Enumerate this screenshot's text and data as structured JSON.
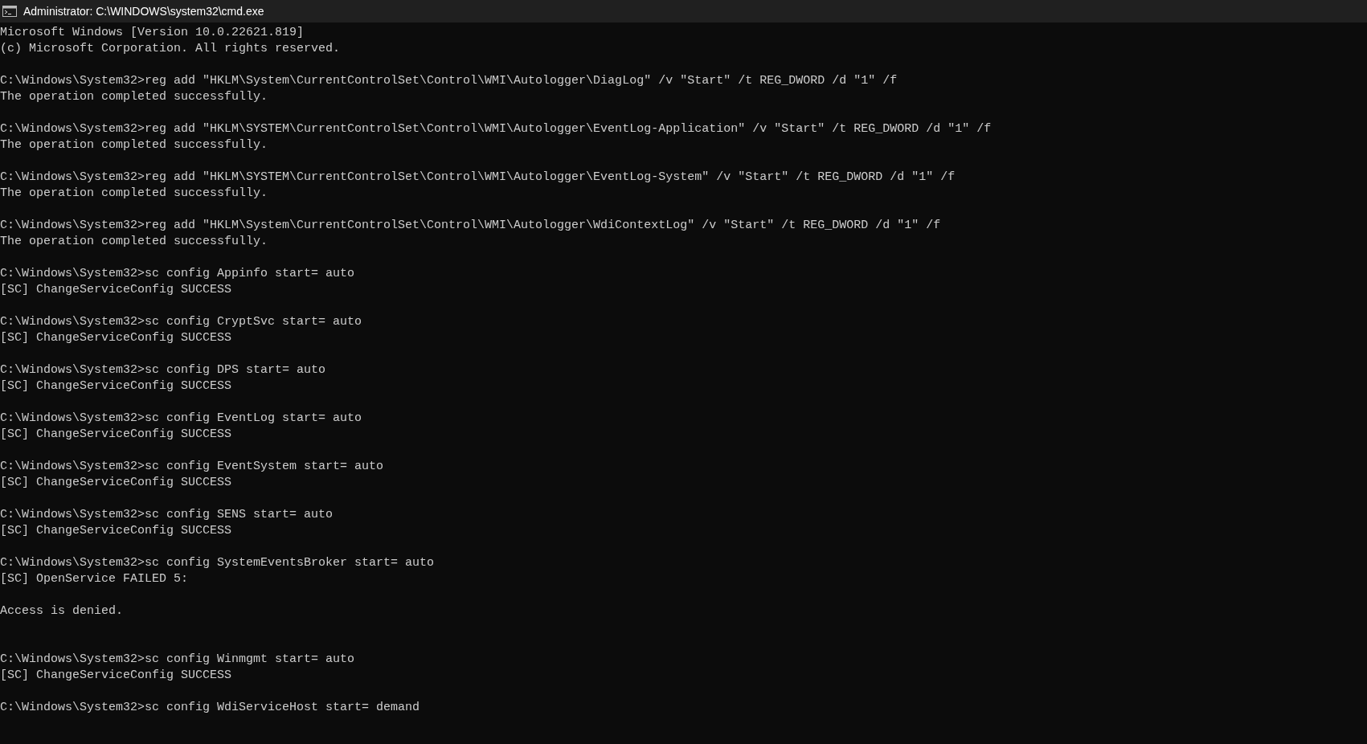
{
  "window": {
    "title": "Administrator: C:\\WINDOWS\\system32\\cmd.exe"
  },
  "console": {
    "lines": [
      {
        "kind": "text",
        "text": "Microsoft Windows [Version 10.0.22621.819]"
      },
      {
        "kind": "text",
        "text": "(c) Microsoft Corporation. All rights reserved."
      },
      {
        "kind": "blank"
      },
      {
        "kind": "text",
        "text": "C:\\Windows\\System32>reg add \"HKLM\\System\\CurrentControlSet\\Control\\WMI\\Autologger\\DiagLog\" /v \"Start\" /t REG_DWORD /d \"1\" /f"
      },
      {
        "kind": "text",
        "text": "The operation completed successfully."
      },
      {
        "kind": "blank"
      },
      {
        "kind": "text",
        "text": "C:\\Windows\\System32>reg add \"HKLM\\SYSTEM\\CurrentControlSet\\Control\\WMI\\Autologger\\EventLog-Application\" /v \"Start\" /t REG_DWORD /d \"1\" /f"
      },
      {
        "kind": "text",
        "text": "The operation completed successfully."
      },
      {
        "kind": "blank"
      },
      {
        "kind": "text",
        "text": "C:\\Windows\\System32>reg add \"HKLM\\SYSTEM\\CurrentControlSet\\Control\\WMI\\Autologger\\EventLog-System\" /v \"Start\" /t REG_DWORD /d \"1\" /f"
      },
      {
        "kind": "text",
        "text": "The operation completed successfully."
      },
      {
        "kind": "blank"
      },
      {
        "kind": "text",
        "text": "C:\\Windows\\System32>reg add \"HKLM\\System\\CurrentControlSet\\Control\\WMI\\Autologger\\WdiContextLog\" /v \"Start\" /t REG_DWORD /d \"1\" /f"
      },
      {
        "kind": "text",
        "text": "The operation completed successfully."
      },
      {
        "kind": "blank"
      },
      {
        "kind": "text",
        "text": "C:\\Windows\\System32>sc config Appinfo start= auto"
      },
      {
        "kind": "text",
        "text": "[SC] ChangeServiceConfig SUCCESS"
      },
      {
        "kind": "blank"
      },
      {
        "kind": "text",
        "text": "C:\\Windows\\System32>sc config CryptSvc start= auto"
      },
      {
        "kind": "text",
        "text": "[SC] ChangeServiceConfig SUCCESS"
      },
      {
        "kind": "blank"
      },
      {
        "kind": "text",
        "text": "C:\\Windows\\System32>sc config DPS start= auto"
      },
      {
        "kind": "text",
        "text": "[SC] ChangeServiceConfig SUCCESS"
      },
      {
        "kind": "blank"
      },
      {
        "kind": "text",
        "text": "C:\\Windows\\System32>sc config EventLog start= auto"
      },
      {
        "kind": "text",
        "text": "[SC] ChangeServiceConfig SUCCESS"
      },
      {
        "kind": "blank"
      },
      {
        "kind": "text",
        "text": "C:\\Windows\\System32>sc config EventSystem start= auto"
      },
      {
        "kind": "text",
        "text": "[SC] ChangeServiceConfig SUCCESS"
      },
      {
        "kind": "blank"
      },
      {
        "kind": "text",
        "text": "C:\\Windows\\System32>sc config SENS start= auto"
      },
      {
        "kind": "text",
        "text": "[SC] ChangeServiceConfig SUCCESS"
      },
      {
        "kind": "blank"
      },
      {
        "kind": "text",
        "text": "C:\\Windows\\System32>sc config SystemEventsBroker start= auto"
      },
      {
        "kind": "text",
        "text": "[SC] OpenService FAILED 5:"
      },
      {
        "kind": "blank"
      },
      {
        "kind": "text",
        "text": "Access is denied."
      },
      {
        "kind": "blank"
      },
      {
        "kind": "blank"
      },
      {
        "kind": "text",
        "text": "C:\\Windows\\System32>sc config Winmgmt start= auto"
      },
      {
        "kind": "text",
        "text": "[SC] ChangeServiceConfig SUCCESS"
      },
      {
        "kind": "blank"
      },
      {
        "kind": "text",
        "text": "C:\\Windows\\System32>sc config WdiServiceHost start= demand"
      }
    ]
  }
}
